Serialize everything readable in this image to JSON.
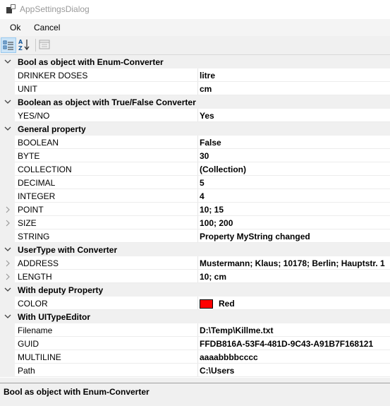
{
  "window": {
    "title": "AppSettingsDialog"
  },
  "menu": {
    "ok_label": "Ok",
    "cancel_label": "Cancel"
  },
  "toolbar": {
    "categorized": "categorized-view-icon",
    "alphabetical": "alphabetical-sort-icon",
    "property_pages": "property-pages-icon"
  },
  "categories": [
    {
      "label": "Bool as object with Enum-Converter",
      "properties": [
        {
          "name": "DRINKER DOSES",
          "value": "litre"
        },
        {
          "name": "UNIT",
          "value": "cm"
        }
      ]
    },
    {
      "label": "Boolean as object with True/False Converter",
      "properties": [
        {
          "name": "YES/NO",
          "value": "Yes"
        }
      ]
    },
    {
      "label": "General property",
      "properties": [
        {
          "name": "BOOLEAN",
          "value": "False"
        },
        {
          "name": "BYTE",
          "value": "30"
        },
        {
          "name": "COLLECTION",
          "value": "(Collection)"
        },
        {
          "name": "DECIMAL",
          "value": "5"
        },
        {
          "name": "INTEGER",
          "value": "4"
        },
        {
          "name": "POINT",
          "value": "10; 15",
          "expandable": true
        },
        {
          "name": "SIZE",
          "value": "100; 200",
          "expandable": true
        },
        {
          "name": "STRING",
          "value": "Property MyString changed"
        }
      ]
    },
    {
      "label": "UserType with Converter",
      "properties": [
        {
          "name": "ADDRESS",
          "value": "Mustermann; Klaus; 10178; Berlin; Hauptstr. 1",
          "expandable": true
        },
        {
          "name": "LENGTH",
          "value": "10; cm",
          "expandable": true
        }
      ]
    },
    {
      "label": "With deputy Property",
      "properties": [
        {
          "name": "COLOR",
          "value": "Red",
          "swatch": "#ff0000"
        }
      ]
    },
    {
      "label": "With UITypeEditor",
      "properties": [
        {
          "name": "Filename",
          "value": "D:\\Temp\\Killme.txt"
        },
        {
          "name": "GUID",
          "value": "FFDB816A-53F4-481D-9C43-A91B7F168121"
        },
        {
          "name": "MULTILINE",
          "value": "aaaabbbbcccc"
        },
        {
          "name": "Path",
          "value": "C:\\Users"
        }
      ]
    }
  ],
  "description": {
    "title": "Bool as object with Enum-Converter"
  }
}
